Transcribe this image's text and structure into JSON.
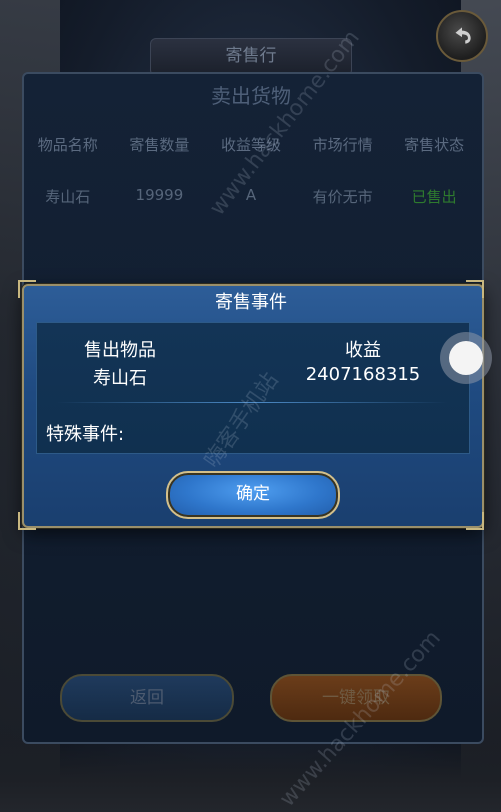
{
  "top_banner": {
    "title": "寄售行"
  },
  "main_panel": {
    "title": "卖出货物",
    "columns": [
      "物品名称",
      "寄售数量",
      "收益等级",
      "市场行情",
      "寄售状态"
    ],
    "row": [
      "寿山石",
      "19999",
      "A",
      "有价无市",
      "已售出"
    ],
    "buttons": {
      "return_label": "返回",
      "collect_label": "一键领取"
    }
  },
  "modal": {
    "title": "寄售事件",
    "sold_item_header": "售出物品",
    "sold_item_value": "寿山石",
    "income_header": "收益",
    "income_value": "2407168315",
    "special_event_label": "特殊事件:",
    "confirm_label": "确定"
  },
  "colors": {
    "sold_status": "#2e7a2e",
    "modal_bg": "#1f4a80",
    "confirm_button": "#2f77cc",
    "gold_frame": "#c8b780"
  },
  "watermarks": [
    "www.hackhome.com",
    "嗨客手机站",
    "www.hackhome.com"
  ],
  "icons": [
    "back-arrow-icon",
    "floating-assist-ball"
  ]
}
